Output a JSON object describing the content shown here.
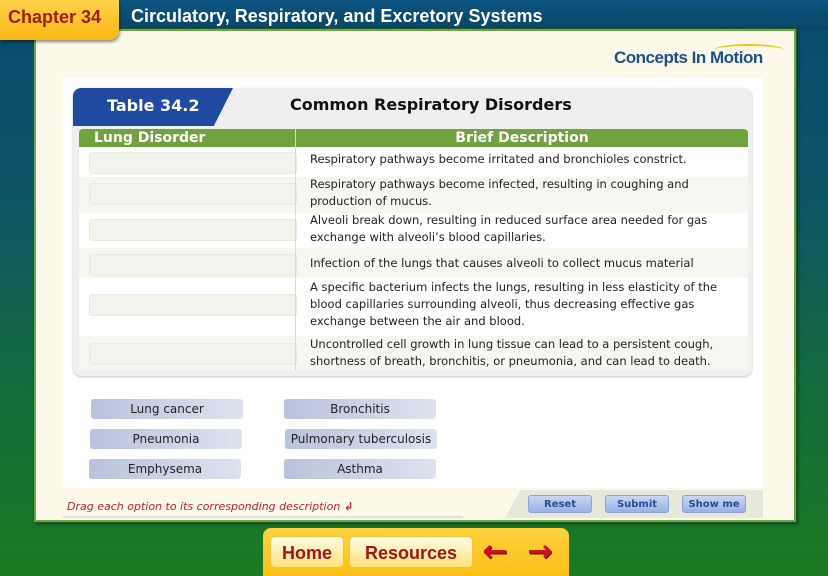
{
  "header": {
    "chapter_label": "Chapter 34",
    "title": "Circulatory, Respiratory, and Excretory Systems",
    "logo_text": "Concepts In Motion"
  },
  "table": {
    "tab_label": "Table 34.2",
    "title": "Common Respiratory Disorders",
    "columns": [
      "Lung Disorder",
      "Brief Description"
    ],
    "rows": [
      {
        "disorder": "",
        "description": "Respiratory pathways become irritated and bronchioles constrict."
      },
      {
        "disorder": "",
        "description": "Respiratory pathways become infected, resulting in coughing and production of mucus."
      },
      {
        "disorder": "",
        "description": "Alveoli break down, resulting in reduced surface area needed for gas exchange with alveoli’s blood capillaries."
      },
      {
        "disorder": "",
        "description": "Infection of the lungs that causes alveoli to collect mucus material"
      },
      {
        "disorder": "",
        "description": "A specific bacterium infects the lungs, resulting in less elasticity of the blood capillaries surrounding alveoli, thus decreasing effective gas exchange between the air and blood."
      },
      {
        "disorder": "",
        "description": "Uncontrolled cell growth in lung tissue can lead to a persistent cough, shortness of breath, bronchitis, or pneumonia, and can lead to death."
      }
    ]
  },
  "options": [
    "Lung cancer",
    "Bronchitis",
    "Pneumonia",
    "Pulmonary tuberculosis",
    "Emphysema",
    "Asthma"
  ],
  "instruction": "Drag each option to its corresponding description",
  "buttons": {
    "reset": "Reset",
    "submit": "Submit",
    "show_me": "Show me"
  },
  "nav": {
    "home": "Home",
    "resources": "Resources",
    "back_icon": "arrow-left",
    "forward_icon": "arrow-right"
  }
}
